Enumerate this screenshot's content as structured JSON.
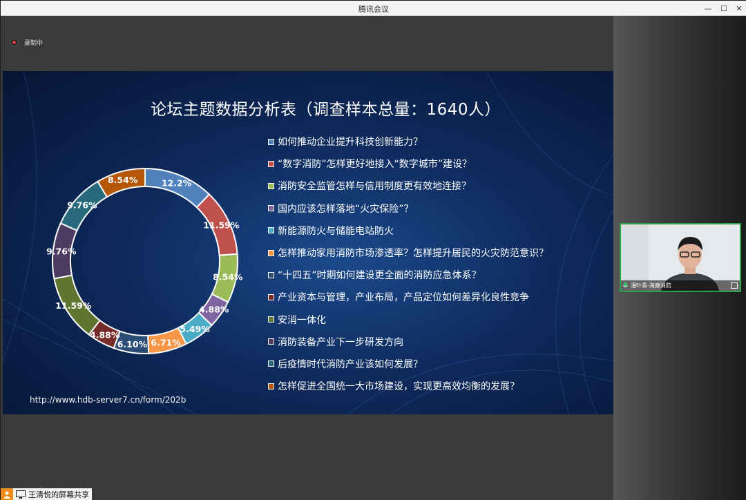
{
  "window": {
    "title": "腾讯会议",
    "controls": {
      "minimize": "—",
      "maximize": "☐",
      "close": "✕"
    }
  },
  "recording": {
    "label": "录制中"
  },
  "slide": {
    "title": "论坛主题数据分析表（调查样本总量：1640人）",
    "url": "http://www.hdb-server7.cn/form/202b",
    "legend": [
      {
        "label": "如何推动企业提升科技创新能力？",
        "color": "#4f81bd"
      },
      {
        "label": "“数字消防”怎样更好地接入“数字城市”建设？",
        "color": "#c0504d"
      },
      {
        "label": "消防安全监管怎样与信用制度更有效地连接？",
        "color": "#9bbb59"
      },
      {
        "label": "国内应该怎样落地“火灾保险”？",
        "color": "#8064a2"
      },
      {
        "label": "新能源防火与储能电站防火",
        "color": "#4bacc6"
      },
      {
        "label": "怎样推动家用消防市场渗透率？怎样提升居民的火灾防范意识？",
        "color": "#f79646"
      },
      {
        "label": "“十四五”时期如何建设更全面的消防应急体系？",
        "color": "#2c4d75"
      },
      {
        "label": "产业资本与管理，产业布局，产品定位如何差异化良性竞争",
        "color": "#772c2a"
      },
      {
        "label": "安消一体化",
        "color": "#5f7530"
      },
      {
        "label": "消防装备产业下一步研发方向",
        "color": "#4d3b62"
      },
      {
        "label": "后疫情时代消防产业该如何发展？",
        "color": "#276a7c"
      },
      {
        "label": "怎样促进全国统一大市场建设，实现更高效均衡的发展？",
        "color": "#b65708"
      }
    ]
  },
  "chart_data": {
    "type": "pie",
    "title": "论坛主题数据分析表（调查样本总量：1640人）",
    "categories": [
      "如何推动企业提升科技创新能力？",
      "“数字消防”怎样更好地接入“数字城市”建设？",
      "消防安全监管怎样与信用制度更有效地连接？",
      "国内应该怎样落地“火灾保险”？",
      "新能源防火与储能电站防火",
      "怎样推动家用消防市场渗透率？怎样提升居民的火灾防范意识？",
      "“十四五”时期如何建设更全面的消防应急体系？",
      "产业资本与管理，产业布局，产品定位如何差异化良性竞争",
      "安消一体化",
      "消防装备产业下一步研发方向",
      "后疫情时代消防产业该如何发展？",
      "怎样促进全国统一大市场建设，实现更高效均衡的发展？"
    ],
    "values": [
      12.2,
      11.59,
      8.54,
      4.88,
      5.49,
      6.71,
      6.1,
      4.88,
      11.59,
      9.76,
      9.76,
      8.54
    ],
    "labels": [
      "12.2%",
      "11.59%",
      "8.54%",
      "4.88%",
      "5.49%",
      "6.71%",
      "6.10%",
      "4.88%",
      "11.59%",
      "9.76%",
      "9.76%",
      "8.54%"
    ],
    "colors": [
      "#4f81bd",
      "#c0504d",
      "#9bbb59",
      "#8064a2",
      "#4bacc6",
      "#f79646",
      "#2c4d75",
      "#772c2a",
      "#5f7530",
      "#4d3b62",
      "#276a7c",
      "#b65708"
    ],
    "style": "doughnut",
    "legend": "right"
  },
  "participant": {
    "name": "潘叶青-海康消防",
    "mic_icon": "mic-icon",
    "camera_icon": "camera-icon"
  },
  "share": {
    "label": "王清悦的屏幕共享"
  }
}
